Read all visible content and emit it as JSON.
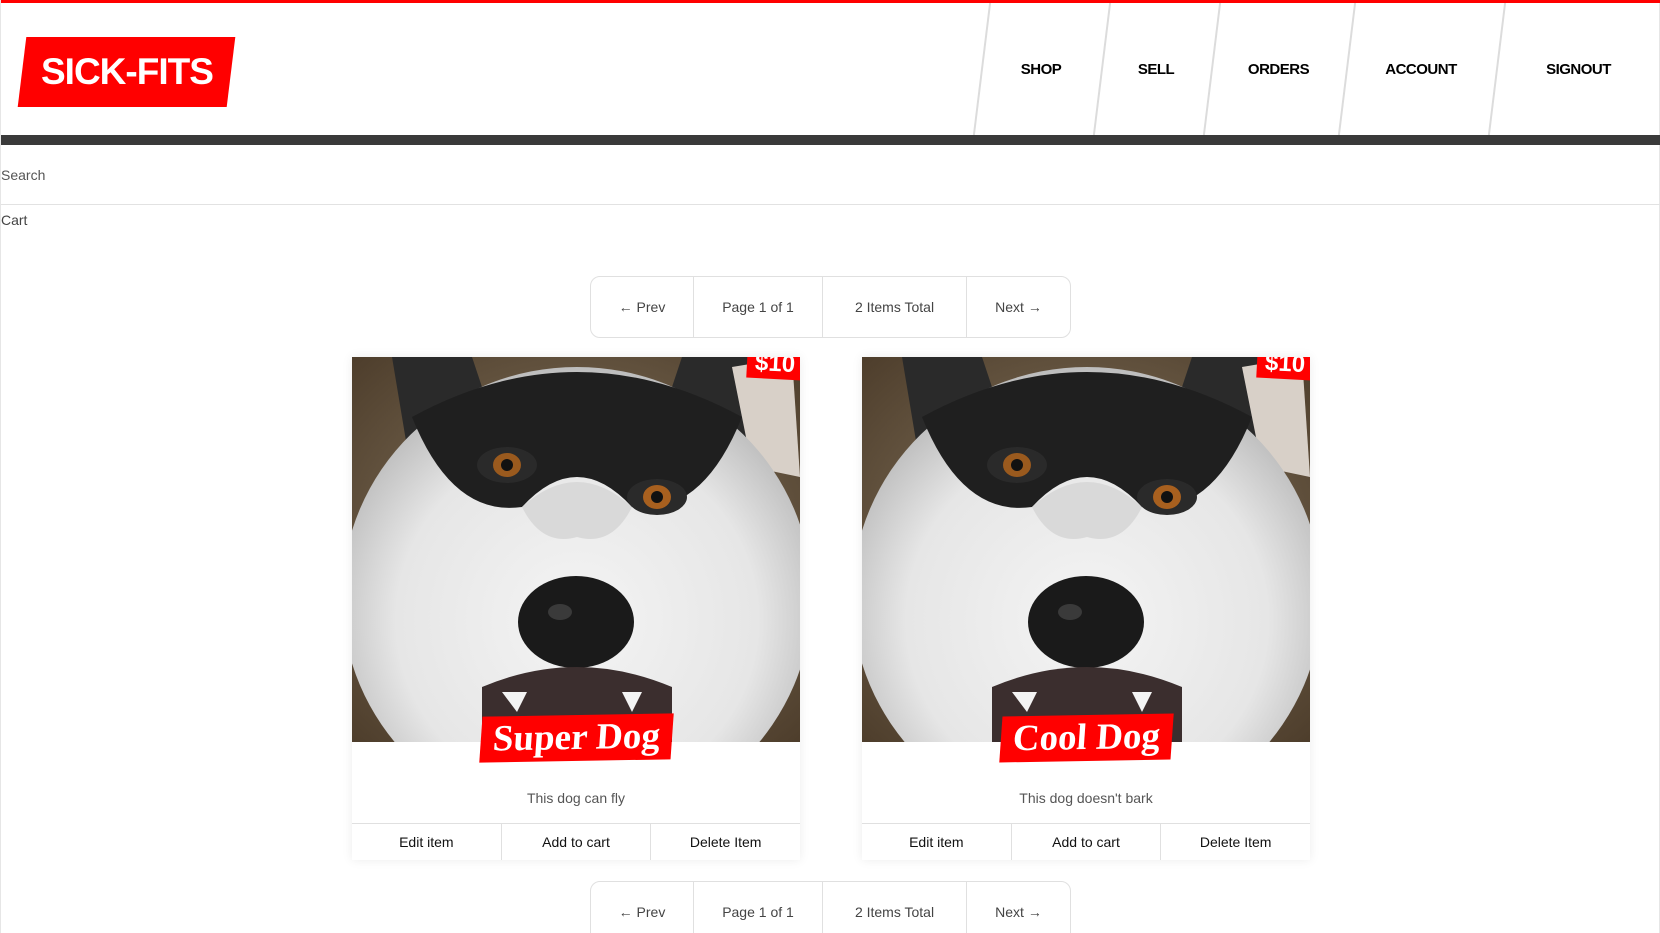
{
  "header": {
    "logo": "SICK-FITS",
    "nav": [
      "SHOP",
      "SELL",
      "ORDERS",
      "ACCOUNT",
      "SIGNOUT"
    ]
  },
  "search": {
    "placeholder": "Search"
  },
  "cart": {
    "label": "Cart"
  },
  "pagination": {
    "prev": "← Prev",
    "page": "Page 1 of 1",
    "total": "2 Items Total",
    "next": "Next →"
  },
  "items": [
    {
      "title": "Super Dog",
      "price": "$10",
      "description": "This dog can fly",
      "image": "husky-dog-photo"
    },
    {
      "title": "Cool Dog",
      "price": "$10",
      "description": "This dog doesn't bark",
      "image": "husky-dog-photo"
    }
  ],
  "item_buttons": {
    "edit": "Edit item",
    "add": "Add to cart",
    "delete": "Delete Item"
  },
  "colors": {
    "accent": "#ff0000",
    "dark_bar": "#3a3a3a",
    "border": "#e0e0e0"
  }
}
